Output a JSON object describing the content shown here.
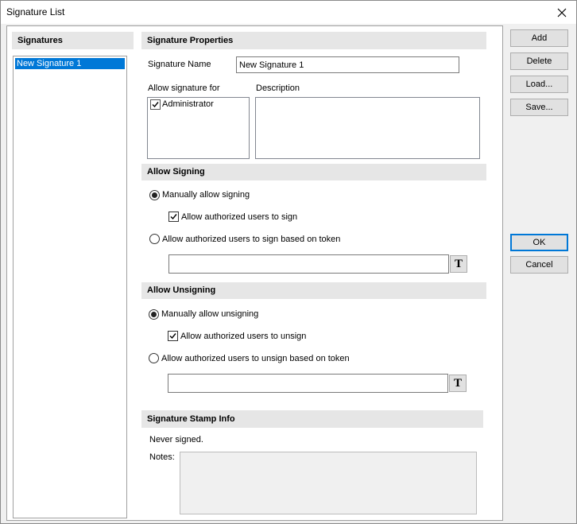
{
  "window": {
    "title": "Signature List"
  },
  "signatures": {
    "header": "Signatures",
    "items": [
      "New Signature 1"
    ]
  },
  "properties": {
    "header": "Signature Properties",
    "name_label": "Signature Name",
    "name_value": "New Signature 1",
    "allow_for_label": "Allow signature for",
    "allow_for_items": [
      {
        "label": "Administrator",
        "checked": true
      }
    ],
    "description_label": "Description",
    "description_value": ""
  },
  "signing": {
    "header": "Allow Signing",
    "manual_label": "Manually allow signing",
    "manual_selected": true,
    "authorized_label": "Allow authorized users to sign",
    "authorized_checked": true,
    "token_label": "Allow authorized users to sign based on token",
    "token_selected": false,
    "token_value": "",
    "token_button": "T"
  },
  "unsigning": {
    "header": "Allow Unsigning",
    "manual_label": "Manually allow unsigning",
    "manual_selected": true,
    "authorized_label": "Allow authorized users to unsign",
    "authorized_checked": true,
    "token_label": "Allow authorized users to unsign based on token",
    "token_selected": false,
    "token_value": "",
    "token_button": "T"
  },
  "stamp": {
    "header": "Signature Stamp Info",
    "status": "Never signed.",
    "notes_label": "Notes:"
  },
  "buttons": {
    "add": "Add",
    "delete": "Delete",
    "load": "Load...",
    "save": "Save...",
    "ok": "OK",
    "cancel": "Cancel"
  },
  "icons": {
    "close": "close-icon",
    "check": "checkmark-icon",
    "text_token": "text-token-icon"
  },
  "colors": {
    "selection": "#0078d7",
    "section_bg": "#e6e6e6",
    "window_bg": "#f0f0f0"
  }
}
